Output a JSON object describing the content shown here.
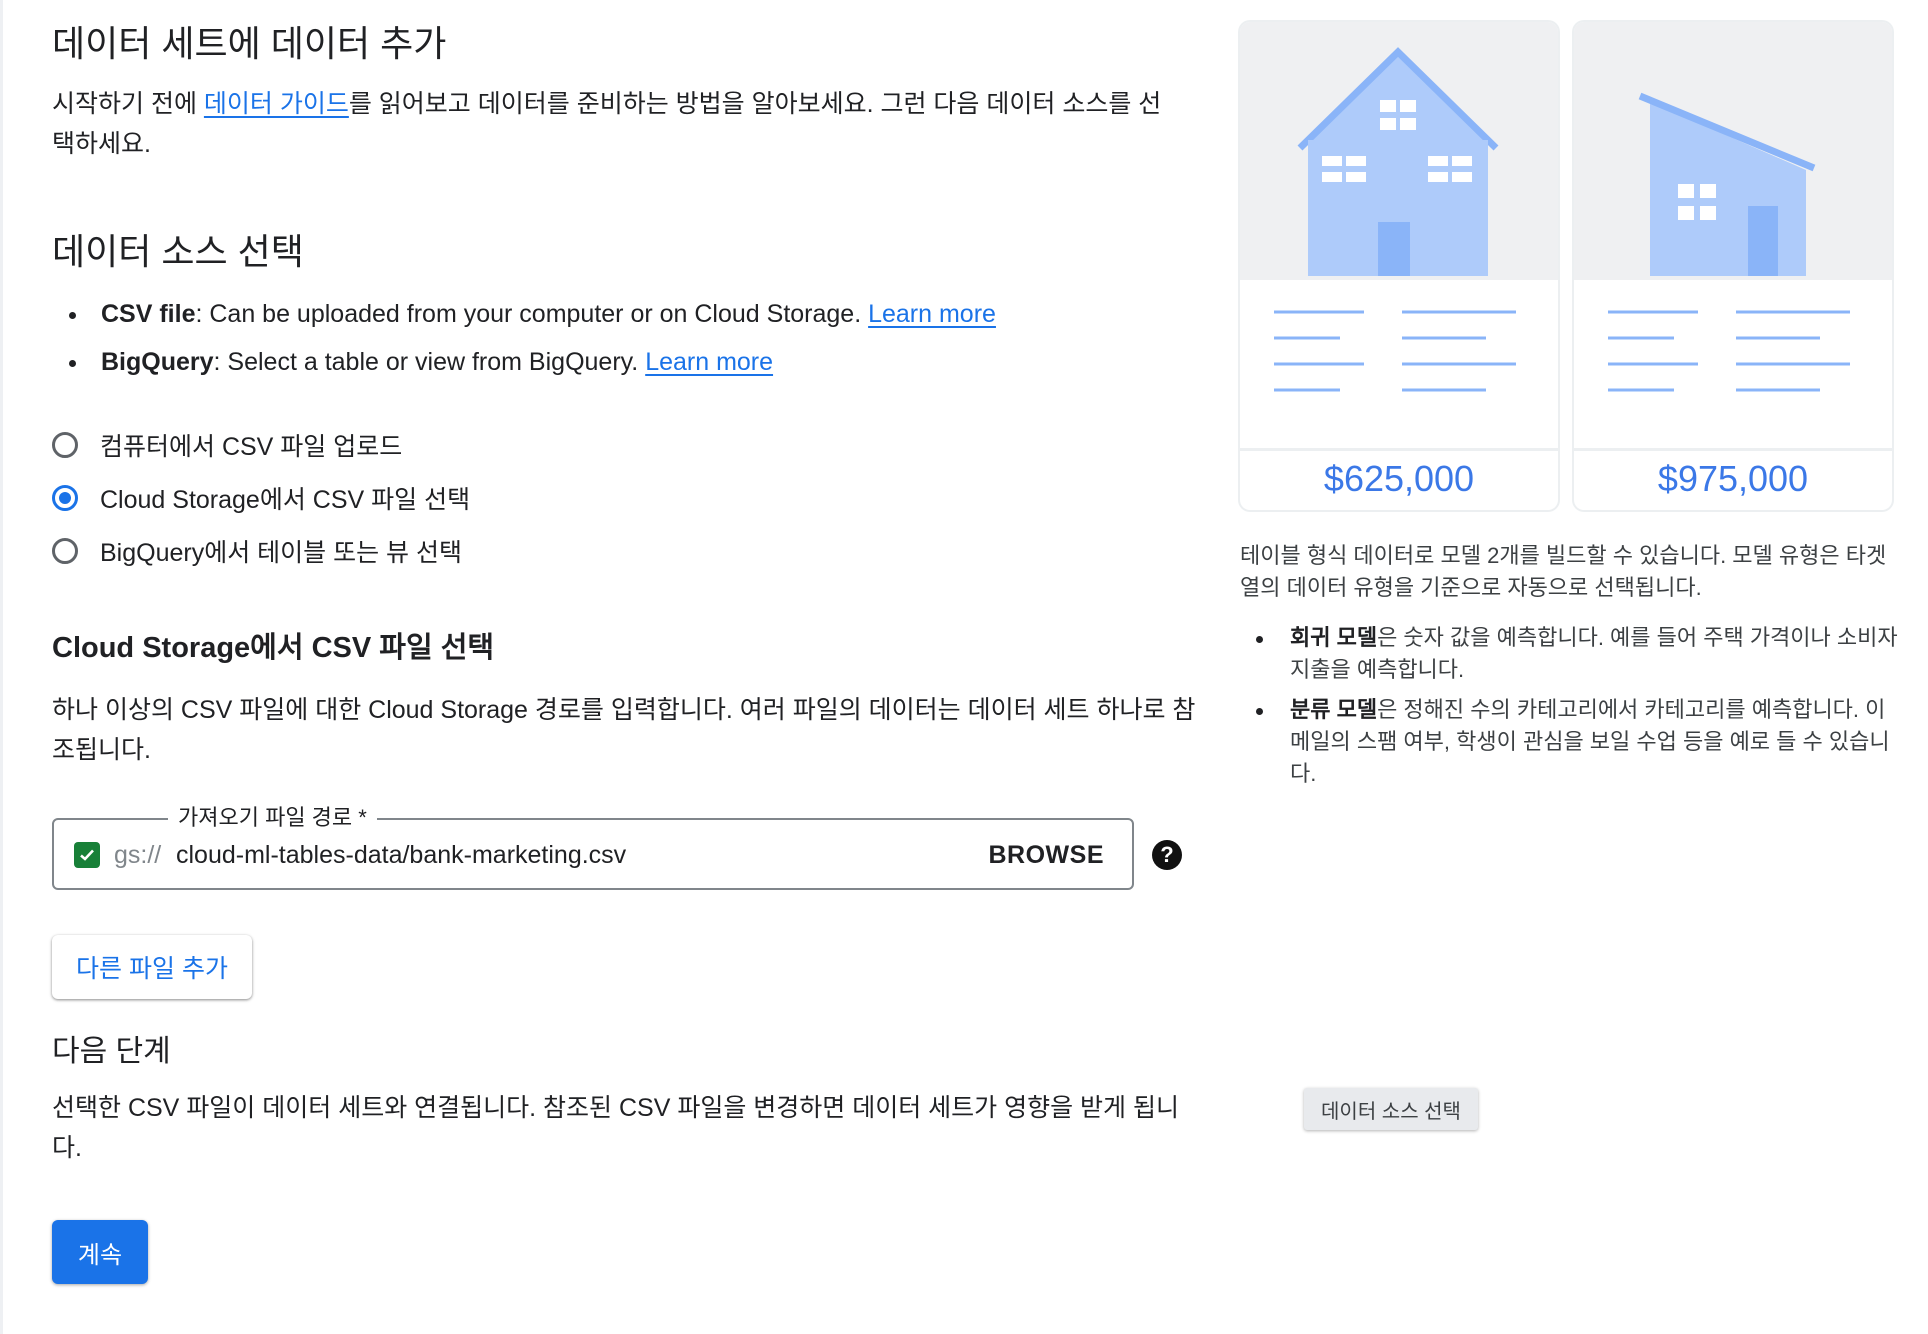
{
  "page": {
    "title": "데이터 세트에 데이터 추가",
    "intro": {
      "prefix": "시작하기 전에 ",
      "link": "데이터 가이드",
      "suffix": "를 읽어보고 데이터를 준비하는 방법을 알아보세요. 그런 다음 데이터 소스를 선택하세요."
    }
  },
  "source": {
    "title": "데이터 소스 선택",
    "bullets": [
      {
        "bold": "CSV file",
        "text": ": Can be uploaded from your computer or on Cloud Storage. ",
        "link": "Learn more"
      },
      {
        "bold": "BigQuery",
        "text": ": Select a table or view from BigQuery. ",
        "link": "Learn more"
      }
    ],
    "options": [
      {
        "label": "컴퓨터에서 CSV 파일 업로드",
        "selected": false
      },
      {
        "label": "Cloud Storage에서 CSV 파일 선택",
        "selected": true
      },
      {
        "label": "BigQuery에서 테이블 또는 뷰 선택",
        "selected": false
      }
    ]
  },
  "gcs": {
    "title": "Cloud Storage에서 CSV 파일 선택",
    "description": "하나 이상의 CSV 파일에 대한 Cloud Storage 경로를 입력합니다. 여러 파일의 데이터는 데이터 세트 하나로 참조됩니다.",
    "field_label": "가져오기 파일 경로 *",
    "prefix": "gs://",
    "value": "cloud-ml-tables-data/bank-marketing.csv",
    "browse_label": "BROWSE",
    "help_glyph": "?",
    "add_file_label": "다른 파일 추가"
  },
  "next": {
    "title": "다음 단계",
    "description": "선택한 CSV 파일이 데이터 세트와 연결됩니다. 참조된 CSV 파일을 변경하면 데이터 세트가 영향을 받게 됩니다.",
    "continue_label": "계속"
  },
  "illustration": {
    "cards": [
      {
        "price": "$625,000",
        "icon": "house-icon"
      },
      {
        "price": "$975,000",
        "icon": "building-icon"
      }
    ]
  },
  "info": {
    "text": "테이블 형식 데이터로 모델 2개를 빌드할 수 있습니다. 모델 유형은 타겟 열의 데이터 유형을 기준으로 자동으로 선택됩니다.",
    "bullets": [
      {
        "bold": "회귀 모델",
        "text": "은 숫자 값을 예측합니다. 예를 들어 주택 가격이나 소비자 지출을 예측합니다."
      },
      {
        "bold": "분류 모델",
        "text": "은 정해진 수의 카테고리에서 카테고리를 예측합니다. 이메일의 스팸 여부, 학생이 관심을 보일 수업 등을 예로 들 수 있습니다."
      }
    ]
  },
  "tooltip": "데이터 소스 선택",
  "colors": {
    "accent": "#1a73e8",
    "checkbox": "#188038",
    "illustration": "#aecbfa"
  }
}
